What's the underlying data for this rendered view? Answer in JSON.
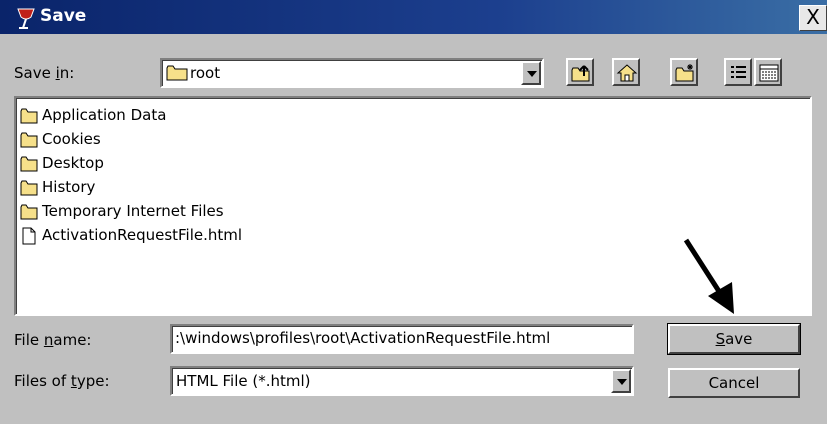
{
  "titlebar": {
    "title": "Save",
    "close_symbol": "X",
    "icon": "wine-glass-icon"
  },
  "save_in": {
    "label_pre": "Save ",
    "label_u": "i",
    "label_post": "n:",
    "value": "root"
  },
  "toolbar": [
    "up-folder-icon",
    "home-icon",
    "new-folder-icon",
    "list-view-icon",
    "details-view-icon"
  ],
  "files": [
    {
      "name": "Application Data",
      "kind": "folder"
    },
    {
      "name": "Cookies",
      "kind": "folder"
    },
    {
      "name": "Desktop",
      "kind": "folder"
    },
    {
      "name": "History",
      "kind": "folder"
    },
    {
      "name": "Temporary Internet Files",
      "kind": "folder"
    },
    {
      "name": "ActivationRequestFile.html",
      "kind": "file"
    }
  ],
  "filename": {
    "label_pre": "File ",
    "label_u": "n",
    "label_post": "ame:",
    "value": ":\\windows\\profiles\\root\\ActivationRequestFile.html"
  },
  "filetype": {
    "label_pre": "Files of ",
    "label_u": "t",
    "label_post": "ype:",
    "value": "HTML File (*.html)"
  },
  "buttons": {
    "save_u": "S",
    "save_rest": "ave",
    "cancel": "Cancel"
  }
}
